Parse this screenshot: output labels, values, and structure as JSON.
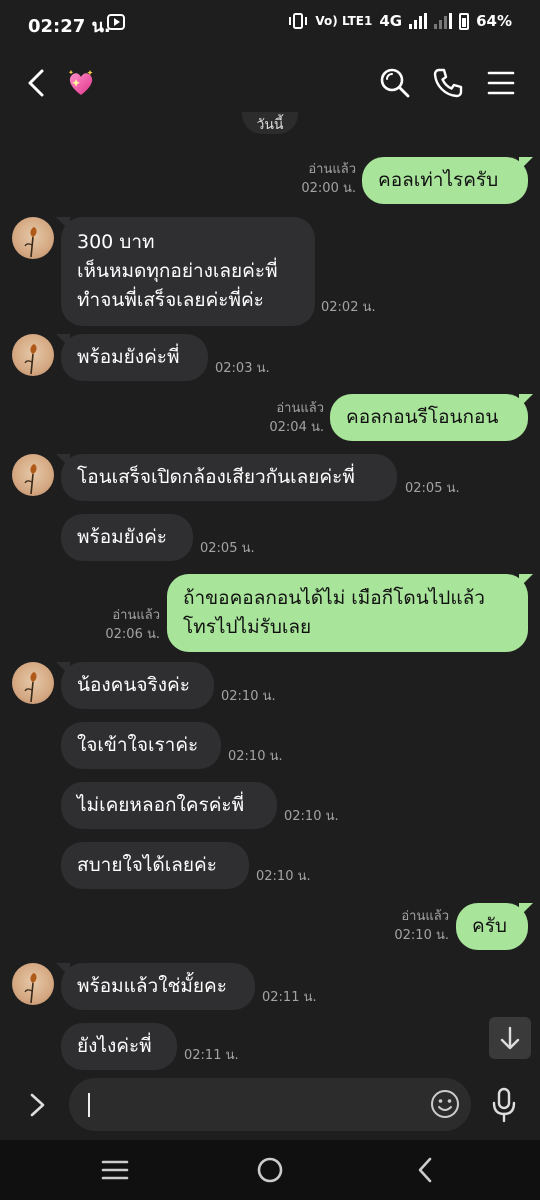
{
  "status": {
    "time": "02:27 น.",
    "network": "4G",
    "volte": "Vo) LTE1",
    "battery": "64%"
  },
  "header": {
    "contact_icon": "sparkling-heart-icon",
    "icons": [
      "back-icon",
      "search-icon",
      "phone-icon",
      "menu-icon"
    ]
  },
  "date_chip": "วันนี้",
  "messages": [
    {
      "side": "out",
      "text": "คอลเท่าไรครับ",
      "read": "อ่านแล้ว",
      "time": "02:00 น."
    },
    {
      "side": "in",
      "lines": [
        "300 บาท",
        "เห็นหมดทุกอย่างเลยค่ะพี่",
        "ทำจนพี่เสร็จเลยค่ะพี่ค่ะ"
      ],
      "time": "02:02 น."
    },
    {
      "side": "in",
      "text": "พร้อมยังค่ะพี่",
      "time": "02:03 น."
    },
    {
      "side": "out",
      "text": "คอลกอนรีโอนกอน",
      "read": "อ่านแล้ว",
      "time": "02:04 น."
    },
    {
      "side": "in",
      "text": "โอนเสร็จเปิดกล้องเสียวกันเลยค่ะพี่",
      "time": "02:05 น."
    },
    {
      "side": "in",
      "text": "พร้อมยังค่ะ",
      "time": "02:05 น."
    },
    {
      "side": "out",
      "lines": [
        "ถ้าขอคอลกอนได้ไม่ เมือกีโดนไปแล้ว",
        "โทรไปไม่รับเลย"
      ],
      "read": "อ่านแล้ว",
      "time": "02:06 น."
    },
    {
      "side": "in",
      "text": "น้องคนจริงค่ะ",
      "time": "02:10 น."
    },
    {
      "side": "in",
      "text": "ใจเข้าใจเราค่ะ",
      "time": "02:10 น."
    },
    {
      "side": "in",
      "text": "ไม่เคยหลอกใครค่ะพี่",
      "time": "02:10 น."
    },
    {
      "side": "in",
      "text": "สบายใจได้เลยค่ะ",
      "time": "02:10 น."
    },
    {
      "side": "out",
      "text": "ครับ",
      "read": "อ่านแล้ว",
      "time": "02:10 น."
    },
    {
      "side": "in",
      "text": "พร้อมแล้วใช่มั้ยคะ",
      "time": "02:11 น."
    },
    {
      "side": "in",
      "text": "ยังไงค่ะพี่",
      "time": "02:11 น."
    }
  ],
  "input": {
    "value": "",
    "icons": [
      "expand-icon",
      "emoji-icon",
      "mic-icon"
    ]
  },
  "colors": {
    "background": "#1e1e1f",
    "incoming": "#2f2f31",
    "outgoing": "#a8e49a",
    "meta": "#a3a3a3"
  }
}
